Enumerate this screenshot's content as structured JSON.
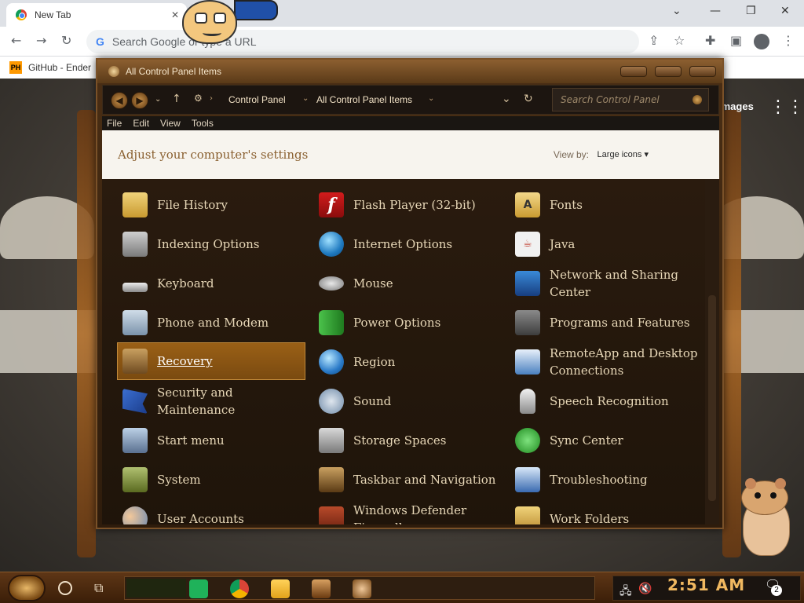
{
  "browser": {
    "tab_title": "New Tab",
    "omnibox_placeholder": "Search Google or type a URL",
    "bookmark_label": "GitHub - Ender",
    "bookmark_favicon_text": "PH"
  },
  "ntp": {
    "images_link": "Images"
  },
  "control_panel": {
    "window_title": "All Control Panel Items",
    "breadcrumb": [
      "Control Panel",
      "All Control Panel Items"
    ],
    "search_placeholder": "Search Control Panel",
    "menu": [
      "File",
      "Edit",
      "View",
      "Tools"
    ],
    "heading": "Adjust your computer's settings",
    "view_by_label": "View by:",
    "view_by_value": "Large icons",
    "selected_item": "Recovery",
    "items": [
      {
        "label": "File History",
        "icon": "file-history-icon"
      },
      {
        "label": "Flash Player (32-bit)",
        "icon": "flash-player-icon"
      },
      {
        "label": "Fonts",
        "icon": "fonts-icon"
      },
      {
        "label": "Indexing Options",
        "icon": "indexing-options-icon"
      },
      {
        "label": "Internet Options",
        "icon": "internet-options-icon"
      },
      {
        "label": "Java",
        "icon": "java-icon"
      },
      {
        "label": "Keyboard",
        "icon": "keyboard-icon"
      },
      {
        "label": "Mouse",
        "icon": "mouse-icon"
      },
      {
        "label": "Network and Sharing Center",
        "icon": "network-sharing-icon"
      },
      {
        "label": "Phone and Modem",
        "icon": "phone-modem-icon"
      },
      {
        "label": "Power Options",
        "icon": "power-options-icon"
      },
      {
        "label": "Programs and Features",
        "icon": "programs-features-icon"
      },
      {
        "label": "Recovery",
        "icon": "recovery-icon"
      },
      {
        "label": "Region",
        "icon": "region-icon"
      },
      {
        "label": "RemoteApp and Desktop Connections",
        "icon": "remoteapp-icon"
      },
      {
        "label": "Security and Maintenance",
        "icon": "security-maintenance-icon"
      },
      {
        "label": "Sound",
        "icon": "sound-icon"
      },
      {
        "label": "Speech Recognition",
        "icon": "speech-recognition-icon"
      },
      {
        "label": "Start menu",
        "icon": "start-menu-icon"
      },
      {
        "label": "Storage Spaces",
        "icon": "storage-spaces-icon"
      },
      {
        "label": "Sync Center",
        "icon": "sync-center-icon"
      },
      {
        "label": "System",
        "icon": "system-icon"
      },
      {
        "label": "Taskbar and Navigation",
        "icon": "taskbar-navigation-icon"
      },
      {
        "label": "Troubleshooting",
        "icon": "troubleshooting-icon"
      },
      {
        "label": "User Accounts",
        "icon": "user-accounts-icon"
      },
      {
        "label": "Windows Defender Firewall",
        "icon": "windows-defender-icon"
      },
      {
        "label": "Work Folders",
        "icon": "work-folders-icon"
      }
    ]
  },
  "taskbar": {
    "clock": "2:51 AM",
    "notification_count": "2"
  }
}
